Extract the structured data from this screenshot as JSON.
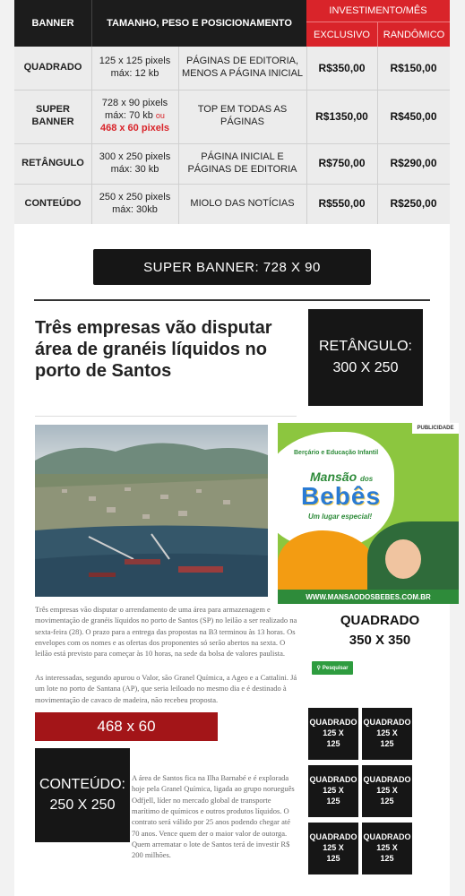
{
  "table": {
    "headers": {
      "banner": "BANNER",
      "size": "TAMANHO, PESO E POSICIONAMENTO",
      "investment": "INVESTIMENTO/MÊS",
      "exclusive": "EXCLUSIVO",
      "random": "RANDÔMICO"
    },
    "rows": [
      {
        "name": "QUADRADO",
        "size1": "125 x 125 pixels",
        "size2": "máx: 12 kb",
        "place1": "PÁGINAS DE EDITORIA,",
        "place2": "MENOS A PÁGINA INICIAL",
        "exclusive": "R$350,00",
        "random": "R$150,00"
      },
      {
        "name": "SUPER BANNER",
        "size1": "728 x 90 pixels",
        "size2": "máx: 70 kb",
        "or": "ou",
        "alt": "468 x 60 pixels",
        "place1": "TOP EM TODAS AS",
        "place2": "PÁGINAS",
        "exclusive": "R$1350,00",
        "random": "R$450,00"
      },
      {
        "name": "RETÂNGULO",
        "size1": "300 x 250 pixels",
        "size2": "máx: 30 kb",
        "place1": "PÁGINA INICIAL E",
        "place2": "PÁGINAS DE EDITORIA",
        "exclusive": "R$750,00",
        "random": "R$290,00"
      },
      {
        "name": "CONTEÚDO",
        "size1": "250 x 250 pixels",
        "size2": "máx: 30kb",
        "place1": "MIOLO DAS NOTÍCIAS",
        "place2": "",
        "exclusive": "R$550,00",
        "random": "R$250,00"
      }
    ]
  },
  "mockup": {
    "super_banner": "SUPER BANNER: 728 X 90",
    "headline": "Três empresas vão disputar área de granéis líquidos no porto de Santos",
    "retangulo_title": "RETÂNGULO:",
    "retangulo_size": "300 X 250",
    "ad": {
      "badge": "PUBLICIDADE",
      "tagline": "Berçário e Educação Infantil",
      "brand1": "Mansão",
      "brand2": "dos",
      "brand3": "Bebês",
      "slogan": "Um lugar especial!",
      "url": "WWW.MANSAODOSBEBES.COM.BR"
    },
    "quadrado_title": "QUADRADO",
    "quadrado_size": "350 X 350",
    "search_button": "Pesquisar",
    "paragraph1": "Três empresas vão disputar o arrendamento de uma área para armazenagem e movimentação de granéis líquidos no porto de Santos (SP) no leilão a ser realizado na sexta-feira (28). O prazo para a entrega das propostas na B3 terminou às 13 horas. Os envelopes com os nomes e as ofertas dos proponentes só serão abertos na sexta. O leilão está previsto para começar às 10 horas, na sede da bolsa de valores paulista.",
    "paragraph2": "As interessadas, segundo apurou o Valor, são Granel Química, a Ageo e a Cattalini. Já um lote no porto de Santana (AP), que seria leiloado no mesmo dia e é destinado à movimentação de cavaco de madeira, não recebeu proposta.",
    "banner_468": "468 x 60",
    "conteudo_title": "CONTEÚDO:",
    "conteudo_size": "250 X 250",
    "paragraph3": "A área de Santos fica na Ilha Barnabé e é explorada hoje pela Granel Química, ligada ao grupo norueguês Odfjell, líder no mercado global de transporte marítimo de químicos e outros produtos líquidos. O contrato será válido por 25 anos podendo chegar até 70 anos. Vence quem der o maior valor de outorga. Quem arrematar o lote de Santos terá de investir R$ 200 milhões.",
    "small_squares": [
      {
        "t": "QUADRADO",
        "a": "125 X",
        "b": "125"
      },
      {
        "t": "QUADRADO",
        "a": "125 X",
        "b": "125"
      },
      {
        "t": "QUADRADO",
        "a": "125 X",
        "b": "125"
      },
      {
        "t": "QUADRADO",
        "a": "125 X",
        "b": "125"
      },
      {
        "t": "QUADRADO",
        "a": "125 X",
        "b": "125"
      },
      {
        "t": "QUADRADO",
        "a": "125 X",
        "b": "125"
      }
    ],
    "colors": {
      "red": "#d9242a",
      "black": "#161616",
      "dark_red": "#a31518",
      "green": "#2e8b3a",
      "orange": "#f39c12"
    }
  }
}
